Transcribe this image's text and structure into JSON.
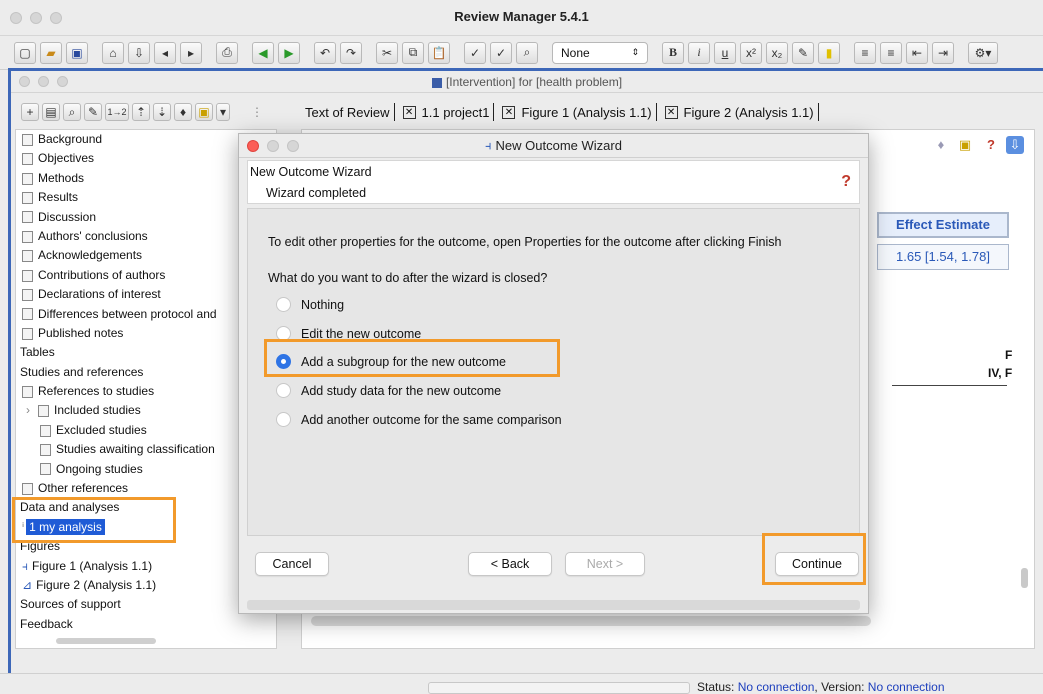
{
  "app": {
    "title": "Review Manager 5.4.1"
  },
  "toolbar": {
    "style_value": "None",
    "style_arrow": "⌃⌄"
  },
  "document": {
    "title": "[Intervention] for [health problem]"
  },
  "tabs": [
    {
      "label": "Text of Review"
    },
    {
      "label": "1.1 project1"
    },
    {
      "label": "Figure 1 (Analysis 1.1)"
    },
    {
      "label": "Figure 2 (Analysis 1.1)"
    }
  ],
  "tree": {
    "items": [
      {
        "label": "Background"
      },
      {
        "label": "Objectives"
      },
      {
        "label": "Methods"
      },
      {
        "label": "Results"
      },
      {
        "label": "Discussion"
      },
      {
        "label": "Authors' conclusions"
      },
      {
        "label": "Acknowledgements"
      },
      {
        "label": "Contributions of authors"
      },
      {
        "label": "Declarations of interest"
      },
      {
        "label": "Differences between protocol and"
      },
      {
        "label": "Published notes"
      },
      {
        "label": "Tables"
      },
      {
        "label": "Studies and references"
      },
      {
        "label": "References to studies"
      },
      {
        "label": "Included studies"
      },
      {
        "label": "Excluded studies"
      },
      {
        "label": "Studies awaiting classification"
      },
      {
        "label": "Ongoing studies"
      },
      {
        "label": "Other references"
      },
      {
        "label": "Data and analyses"
      },
      {
        "label": "1 my analysis"
      },
      {
        "label": "Figures"
      },
      {
        "label": "Figure 1 (Analysis 1.1)"
      },
      {
        "label": "Figure 2 (Analysis 1.1)"
      },
      {
        "label": "Sources of support"
      },
      {
        "label": "Feedback"
      }
    ]
  },
  "content": {
    "effect_header": "Effect Estimate",
    "effect_value": "1.65 [1.54, 1.78]",
    "col_a": "IV, F",
    "col_b": "F"
  },
  "dialog": {
    "title": "New Outcome Wizard",
    "header_title": "New Outcome Wizard",
    "header_sub": "Wizard completed",
    "help": "?",
    "note": "To edit other properties for the outcome, open Properties for the outcome after clicking Finish",
    "question": "What do you want to do after the wizard is closed?",
    "options": [
      {
        "label": "Nothing",
        "selected": false
      },
      {
        "label": "Edit the new outcome",
        "selected": false
      },
      {
        "label": "Add a subgroup for the new outcome",
        "selected": true
      },
      {
        "label": "Add study data for the new outcome",
        "selected": false
      },
      {
        "label": "Add another outcome for the same comparison",
        "selected": false
      }
    ],
    "buttons": {
      "cancel": "Cancel",
      "back": "< Back",
      "next": "Next >",
      "continue": "Continue"
    }
  },
  "status": {
    "label_status": "Status:",
    "status": "No connection",
    "label_version": "Version:",
    "version": "No connection"
  },
  "colors": {
    "highlight": "#f29a2b",
    "selection": "#1f5bd6",
    "link": "#2a59b8"
  }
}
